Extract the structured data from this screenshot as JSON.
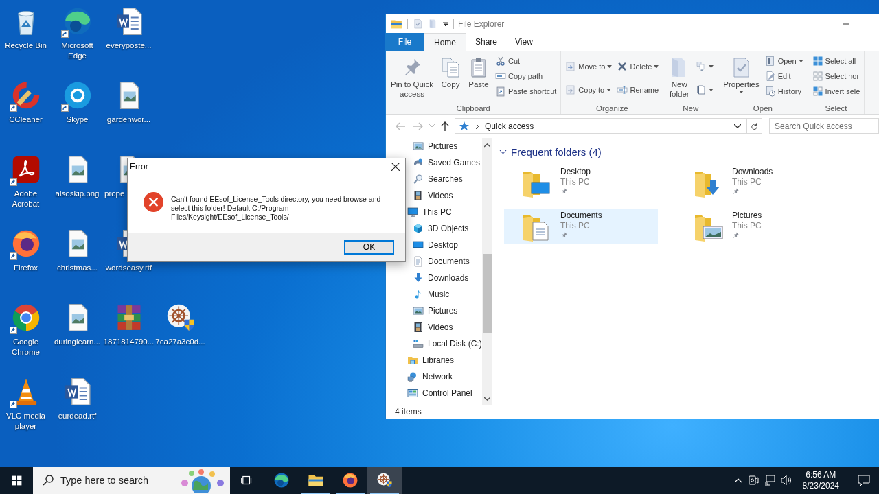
{
  "desktop": {
    "icon_rows": [
      [
        {
          "label": "Recycle Bin",
          "kind": "recycle",
          "shortcut": false,
          "covered": false
        },
        {
          "label": "Microsoft Edge",
          "kind": "edge",
          "shortcut": true,
          "covered": false
        },
        {
          "label": "everyposte...",
          "kind": "word",
          "shortcut": false,
          "covered": false
        }
      ],
      [
        {
          "label": "CCleaner",
          "kind": "ccleaner",
          "shortcut": true,
          "covered": false
        },
        {
          "label": "Skype",
          "kind": "skype",
          "shortcut": true,
          "covered": false
        },
        {
          "label": "gardenwor...",
          "kind": "image",
          "shortcut": false,
          "covered": false
        }
      ],
      [
        {
          "label": "Adobe Acrobat",
          "kind": "acrobat",
          "shortcut": true,
          "covered": false
        },
        {
          "label": "alsoskip.png",
          "kind": "image",
          "shortcut": false,
          "covered": false
        },
        {
          "label": "prope",
          "kind": "image",
          "shortcut": false,
          "covered": true
        }
      ],
      [
        {
          "label": "Firefox",
          "kind": "firefox",
          "shortcut": true,
          "covered": false
        },
        {
          "label": "christmas...",
          "kind": "image",
          "shortcut": false,
          "covered": false
        },
        {
          "label": "wordseasy.rtf",
          "kind": "word",
          "shortcut": false,
          "covered": false
        }
      ],
      [
        {
          "label": "Google Chrome",
          "kind": "chrome",
          "shortcut": true,
          "covered": false
        },
        {
          "label": "duringlearn...",
          "kind": "image",
          "shortcut": false,
          "covered": false
        },
        {
          "label": "1871814790...",
          "kind": "winrar",
          "shortcut": false,
          "covered": false
        },
        {
          "label": "7ca27a3c0d...",
          "kind": "setup",
          "shortcut": false,
          "covered": false
        }
      ],
      [
        {
          "label": "VLC media player",
          "kind": "vlc",
          "shortcut": true,
          "covered": false
        },
        {
          "label": "eurdead.rtf",
          "kind": "word",
          "shortcut": false,
          "covered": false
        }
      ]
    ]
  },
  "error_dialog": {
    "title": "Error",
    "message": "Can't found EEsof_License_Tools directory, you need browse and select this folder! Default C:/Program Files/Keysight/EEsof_License_Tools/",
    "button": "OK"
  },
  "explorer": {
    "title": "File Explorer",
    "file_menu": "File",
    "tabs": [
      {
        "label": "Home",
        "selected": true
      },
      {
        "label": "Share",
        "selected": false
      },
      {
        "label": "View",
        "selected": false
      }
    ],
    "ribbon": [
      {
        "label": "Clipboard",
        "columns": [
          [
            {
              "label": "Pin to Quick\naccess",
              "kind": "pin",
              "dropdown": false
            }
          ],
          [
            {
              "label": "Copy",
              "kind": "copy",
              "dropdown": false
            }
          ],
          [
            {
              "label": "Paste",
              "kind": "paste",
              "dropdown": false
            }
          ],
          [
            {
              "label": "Cut",
              "kind": "cut",
              "dropdown": false
            },
            {
              "label": "Copy path",
              "kind": "copypath",
              "dropdown": false
            },
            {
              "label": "Paste shortcut",
              "kind": "pasteshortcut",
              "dropdown": false
            }
          ]
        ]
      },
      {
        "label": "Organize",
        "columns": [
          [
            {
              "label": "Move to",
              "kind": "moveto",
              "dropdown": true
            },
            {
              "label": "Copy to",
              "kind": "copyto",
              "dropdown": true
            }
          ],
          [
            {
              "label": "Delete",
              "kind": "delete",
              "dropdown": true
            },
            {
              "label": "Rename",
              "kind": "rename",
              "dropdown": false
            }
          ]
        ]
      },
      {
        "label": "New",
        "columns": [
          [
            {
              "label": "New\nfolder",
              "kind": "newfolder",
              "dropdown": false
            }
          ],
          [
            {
              "kind": "newitem",
              "dropdown": true
            },
            {
              "kind": "easyaccess",
              "dropdown": true
            }
          ]
        ]
      },
      {
        "label": "Open",
        "columns": [
          [
            {
              "label": "Properties",
              "kind": "properties",
              "dropdown": true
            }
          ],
          [
            {
              "label": "Open",
              "kind": "open",
              "dropdown": true
            },
            {
              "label": "Edit",
              "kind": "edit",
              "dropdown": false
            },
            {
              "label": "History",
              "kind": "history",
              "dropdown": false
            }
          ]
        ]
      },
      {
        "label": "Select",
        "columns": [
          [
            {
              "label": "Select all",
              "kind": "selectall",
              "dropdown": false
            },
            {
              "label": "Select nor",
              "kind": "selectnone",
              "dropdown": false
            },
            {
              "label": "Invert sele",
              "kind": "invert",
              "dropdown": false
            }
          ]
        ]
      }
    ],
    "address": {
      "path": "Quick access",
      "search_placeholder": "Search Quick access"
    },
    "nav_pane": {
      "partial_children": [
        {
          "label": "Pictures",
          "kind": "pictures"
        },
        {
          "label": "Saved Games",
          "kind": "savedgames"
        },
        {
          "label": "Searches",
          "kind": "searches"
        },
        {
          "label": "Videos",
          "kind": "videos"
        }
      ],
      "items": [
        {
          "label": "This PC",
          "kind": "thispc",
          "children": [
            {
              "label": "3D Objects",
              "kind": "cube"
            },
            {
              "label": "Desktop",
              "kind": "desktop"
            },
            {
              "label": "Documents",
              "kind": "documents"
            },
            {
              "label": "Downloads",
              "kind": "downloads"
            },
            {
              "label": "Music",
              "kind": "music"
            },
            {
              "label": "Pictures",
              "kind": "pictures"
            },
            {
              "label": "Videos",
              "kind": "videos"
            },
            {
              "label": "Local Disk (C:)",
              "kind": "disk"
            }
          ]
        },
        {
          "label": "Libraries",
          "kind": "libraries"
        },
        {
          "label": "Network",
          "kind": "network"
        },
        {
          "label": "Control Panel",
          "kind": "controlpanel"
        }
      ]
    },
    "content": {
      "section": "Frequent folders (4)",
      "expanded": true,
      "folders": [
        {
          "name": "Desktop",
          "location": "This PC",
          "kind": "desktop",
          "selected": false,
          "pinned": true
        },
        {
          "name": "Downloads",
          "location": "This PC",
          "kind": "downloads",
          "selected": false,
          "pinned": true
        },
        {
          "name": "Documents",
          "location": "This PC",
          "kind": "documents",
          "selected": true,
          "pinned": true
        },
        {
          "name": "Pictures",
          "location": "This PC",
          "kind": "pictures",
          "selected": false,
          "pinned": true
        }
      ]
    },
    "status_bar": "4 items"
  },
  "taskbar": {
    "search_placeholder": "Type here to search",
    "apps": [
      {
        "kind": "taskview",
        "running": false,
        "selected": false
      },
      {
        "kind": "edge",
        "running": false,
        "selected": false
      },
      {
        "kind": "explorer",
        "running": true,
        "selected": false
      },
      {
        "kind": "firefox",
        "running": true,
        "selected": false
      },
      {
        "kind": "setup",
        "running": true,
        "selected": true
      }
    ],
    "time": "6:56 AM",
    "date": "8/23/2024"
  }
}
